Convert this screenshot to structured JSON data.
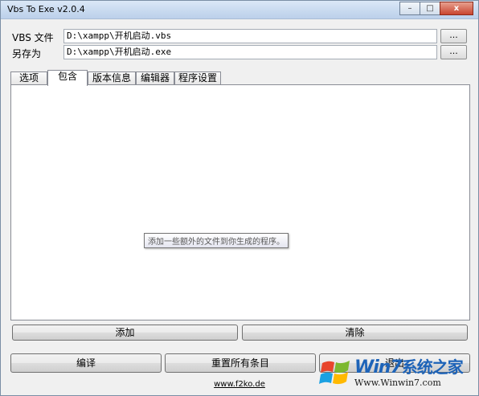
{
  "window": {
    "title": "Vbs To Exe v2.0.4",
    "controls": {
      "minimize": "–",
      "maximize": "□",
      "close": "x"
    }
  },
  "form": {
    "vbs_label": "VBS 文件",
    "vbs_path": "D:\\xampp\\开机启动.vbs",
    "saveas_label": "另存为",
    "saveas_path": "D:\\xampp\\开机启动.exe",
    "browse_label": "..."
  },
  "tabs": [
    {
      "label": "选项",
      "active": false
    },
    {
      "label": "包含",
      "active": true
    },
    {
      "label": "版本信息",
      "active": false
    },
    {
      "label": "编辑器",
      "active": false
    },
    {
      "label": "程序设置",
      "active": false
    }
  ],
  "panel": {
    "tooltip": "添加一些额外的文件到你生成的程序。"
  },
  "panel_buttons": {
    "add": "添加",
    "clear": "清除"
  },
  "bottom_buttons": {
    "compile": "编译",
    "reset": "重置所有条目",
    "exit": "退出"
  },
  "footer": {
    "link": "www.f2ko.de"
  },
  "watermark": {
    "brand_main": "Win7",
    "brand_cn": "系统之家",
    "url": "Www.Winwin7.com"
  }
}
